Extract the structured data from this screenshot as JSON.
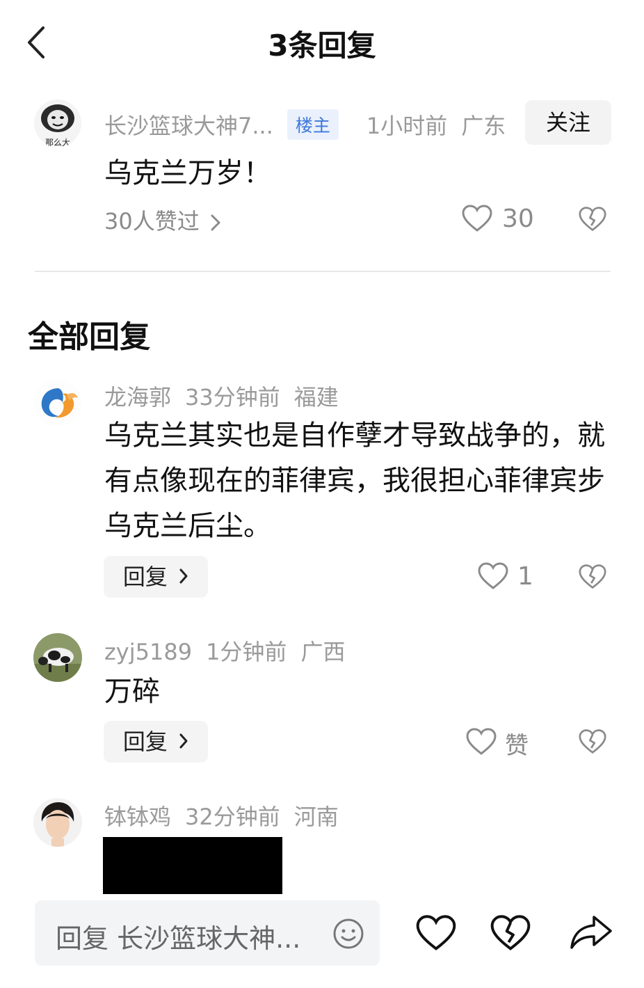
{
  "header": {
    "title": "3条回复"
  },
  "op": {
    "username": "长沙篮球大神7...",
    "badge": "楼主",
    "time": "1小时前",
    "location": "广东",
    "follow_label": "关注",
    "avatar_caption": "那么大",
    "text": "乌克兰万岁！",
    "likers_text": "30人赞过",
    "like_count": "30"
  },
  "section_title": "全部回复",
  "replies": [
    {
      "username": "龙海郭",
      "time": "33分钟前",
      "location": "福建",
      "text": "乌克兰其实也是自作孽才导致战争的，就有点像现在的菲律宾，我很担心菲律宾步乌克兰后尘。",
      "reply_label": "回复",
      "like_count": "1"
    },
    {
      "username": "zyj5189",
      "time": "1分钟前",
      "location": "广西",
      "text": "万碎",
      "reply_label": "回复",
      "like_label": "赞"
    },
    {
      "username": "钵钵鸡",
      "time": "32分钟前",
      "location": "河南"
    }
  ],
  "bottom_bar": {
    "input_placeholder": "回复 长沙篮球大神..."
  },
  "colors": {
    "accent_blue": "#3e78d8",
    "badge_bg": "#eaf1fd",
    "muted": "#9a9a9a"
  }
}
